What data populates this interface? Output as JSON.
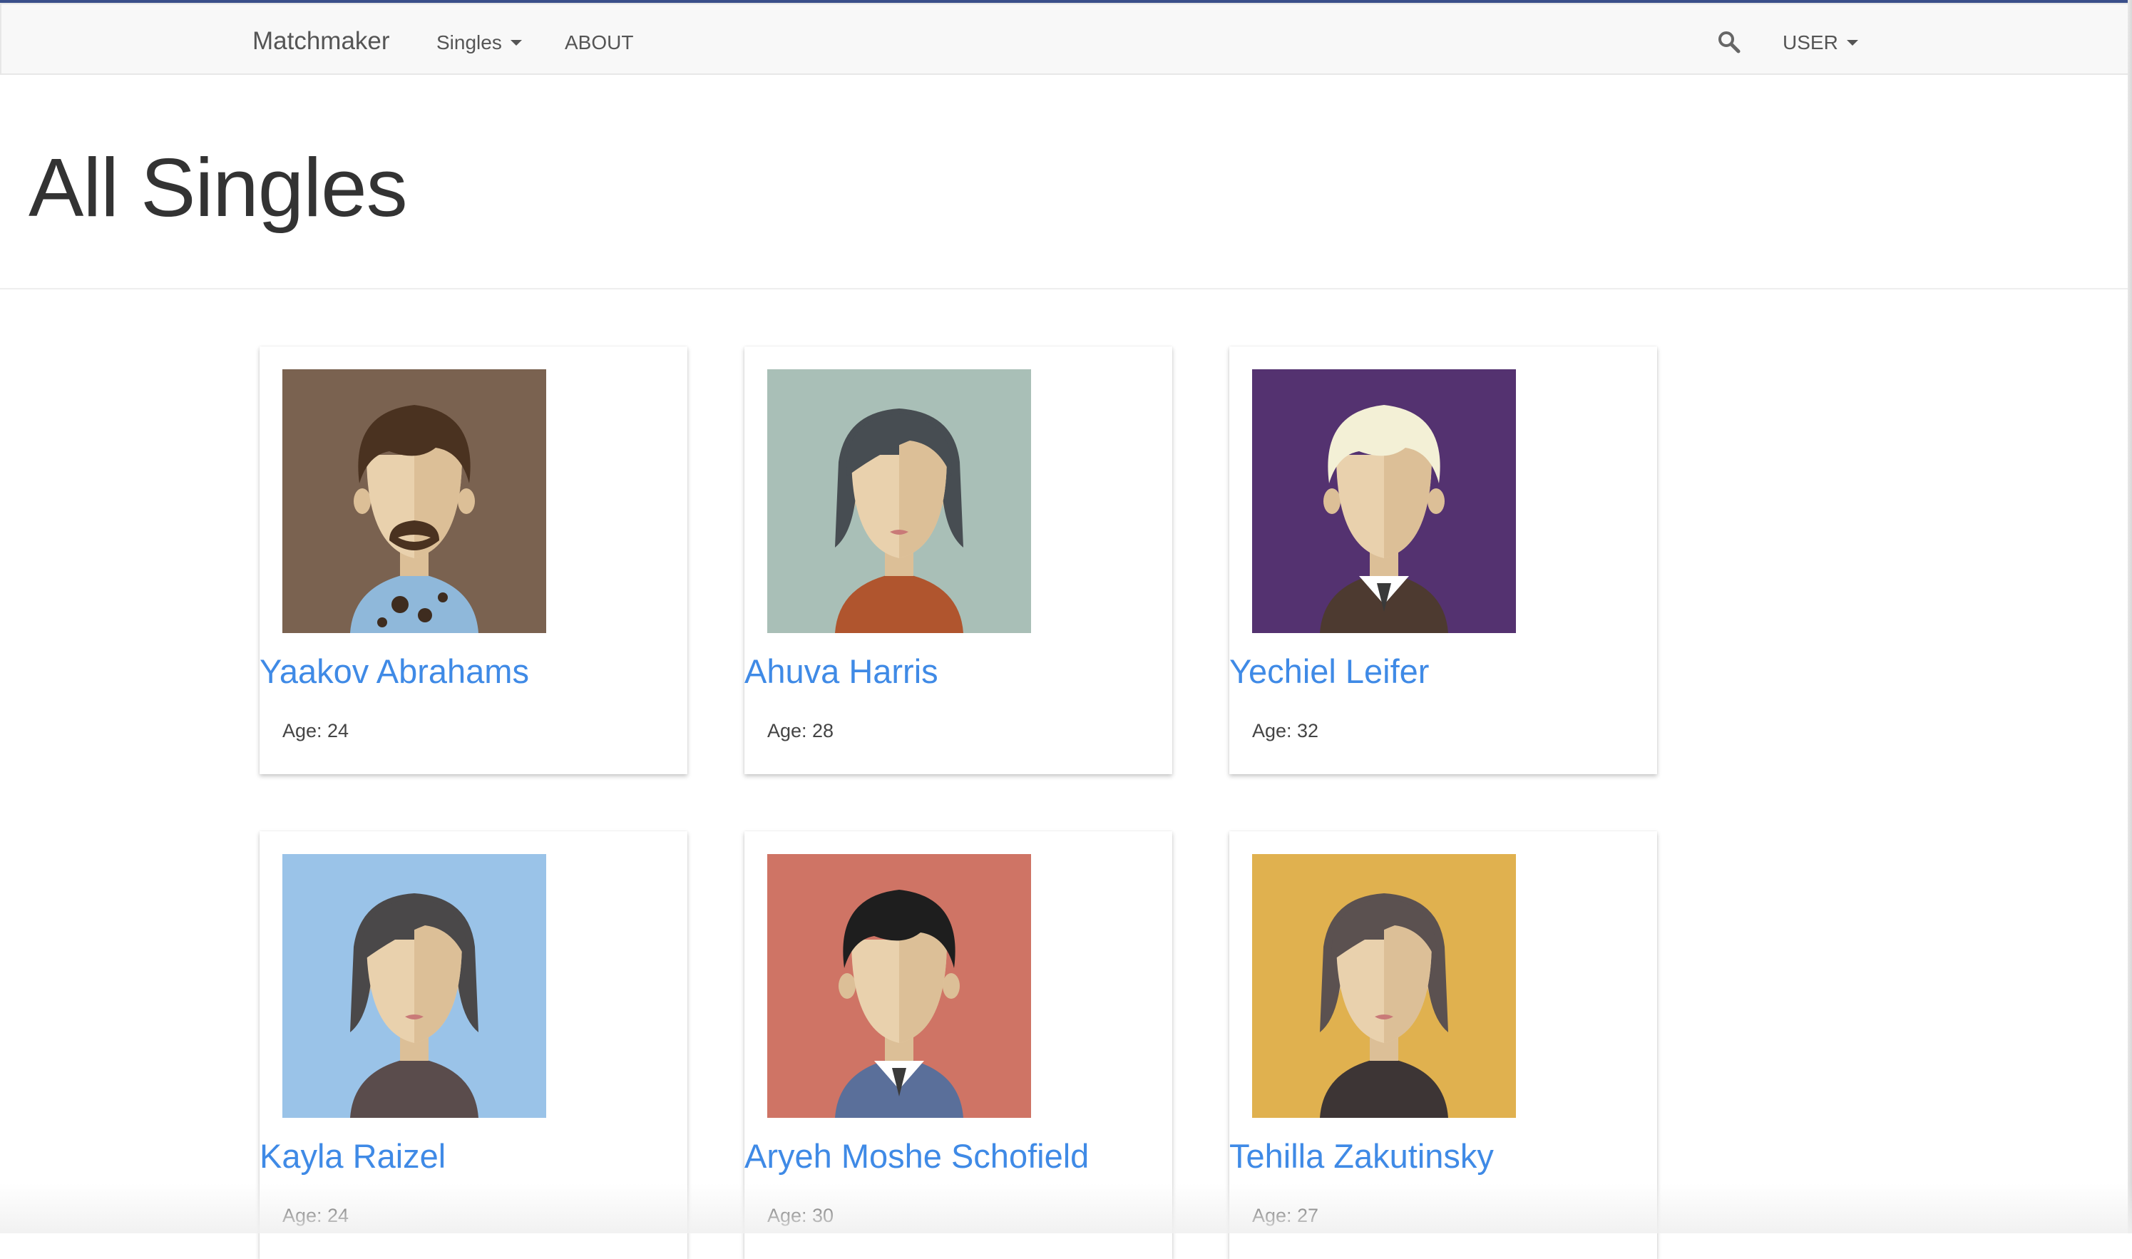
{
  "navbar": {
    "brand": "Matchmaker",
    "singles_label": "Singles",
    "about_label": "ABOUT",
    "user_label": "USER",
    "search_icon": "search-icon"
  },
  "page": {
    "title": "All Singles"
  },
  "age_prefix": "Age: ",
  "singles": [
    {
      "name": "Yaakov Abrahams",
      "age": "24",
      "age_label": "Age: 24",
      "bg": "#7a6250",
      "hair": "#4a3220",
      "shirt": "#8fb8da",
      "gender": "m",
      "avatar_style": "beard"
    },
    {
      "name": "Ahuva Harris",
      "age": "28",
      "age_label": "Age: 28",
      "bg": "#a9bfb7",
      "hair": "#474d52",
      "shirt": "#b0552e",
      "gender": "f",
      "avatar_style": "bob"
    },
    {
      "name": "Yechiel Leifer",
      "age": "32",
      "age_label": "Age: 32",
      "bg": "#543270",
      "hair": "#f3f0d6",
      "shirt": "#4d3a30",
      "gender": "m",
      "avatar_style": "suit"
    },
    {
      "name": "Kayla Raizel",
      "age": "24",
      "age_label": "Age: 24",
      "bg": "#9ac3e8",
      "hair": "#4a4849",
      "shirt": "#5a4c4c",
      "gender": "f",
      "avatar_style": "short"
    },
    {
      "name": "Aryeh Moshe Schofield",
      "age": "30",
      "age_label": "Age: 30",
      "bg": "#cf7465",
      "hair": "#1e1e1e",
      "shirt": "#5a6f9a",
      "gender": "m",
      "avatar_style": "suit"
    },
    {
      "name": "Tehilla Zakutinsky",
      "age": "27",
      "age_label": "Age: 27",
      "bg": "#e0b14f",
      "hair": "#5b5150",
      "shirt": "#3d3535",
      "gender": "f",
      "avatar_style": "wavy"
    }
  ]
}
